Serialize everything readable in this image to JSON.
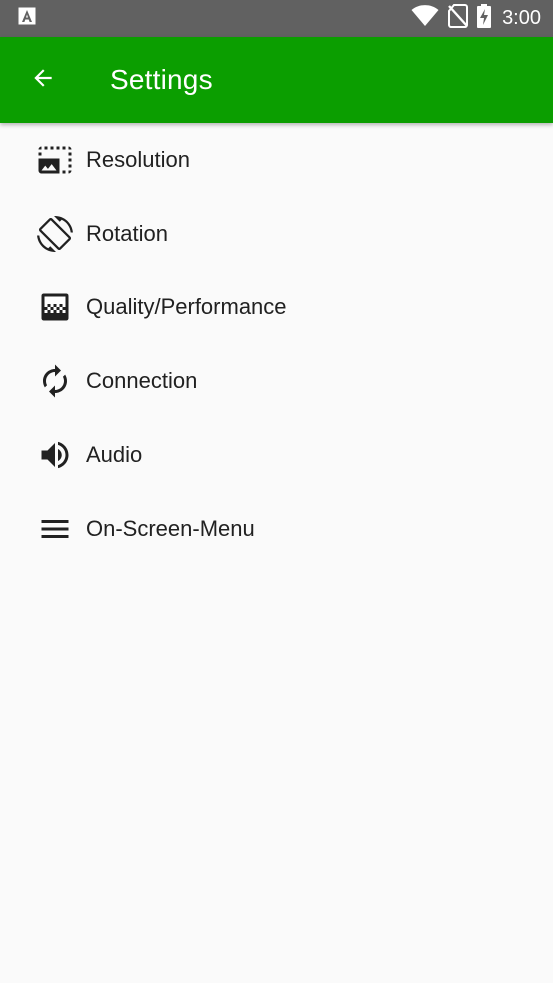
{
  "status_bar": {
    "notification_icon": "a-icon",
    "time": "3:00",
    "icons": [
      "wifi-icon",
      "no-sim-icon",
      "battery-charging-icon"
    ]
  },
  "app_bar": {
    "back_icon": "arrow-back-icon",
    "title": "Settings",
    "color": "#0b9e00"
  },
  "settings": {
    "items": [
      {
        "label": "Resolution",
        "icon": "photo-size-select-icon"
      },
      {
        "label": "Rotation",
        "icon": "screen-rotation-icon"
      },
      {
        "label": "Quality/Performance",
        "icon": "gradient-icon"
      },
      {
        "label": "Connection",
        "icon": "autorenew-icon"
      },
      {
        "label": "Audio",
        "icon": "volume-up-icon"
      },
      {
        "label": "On-Screen-Menu",
        "icon": "menu-icon"
      }
    ]
  }
}
